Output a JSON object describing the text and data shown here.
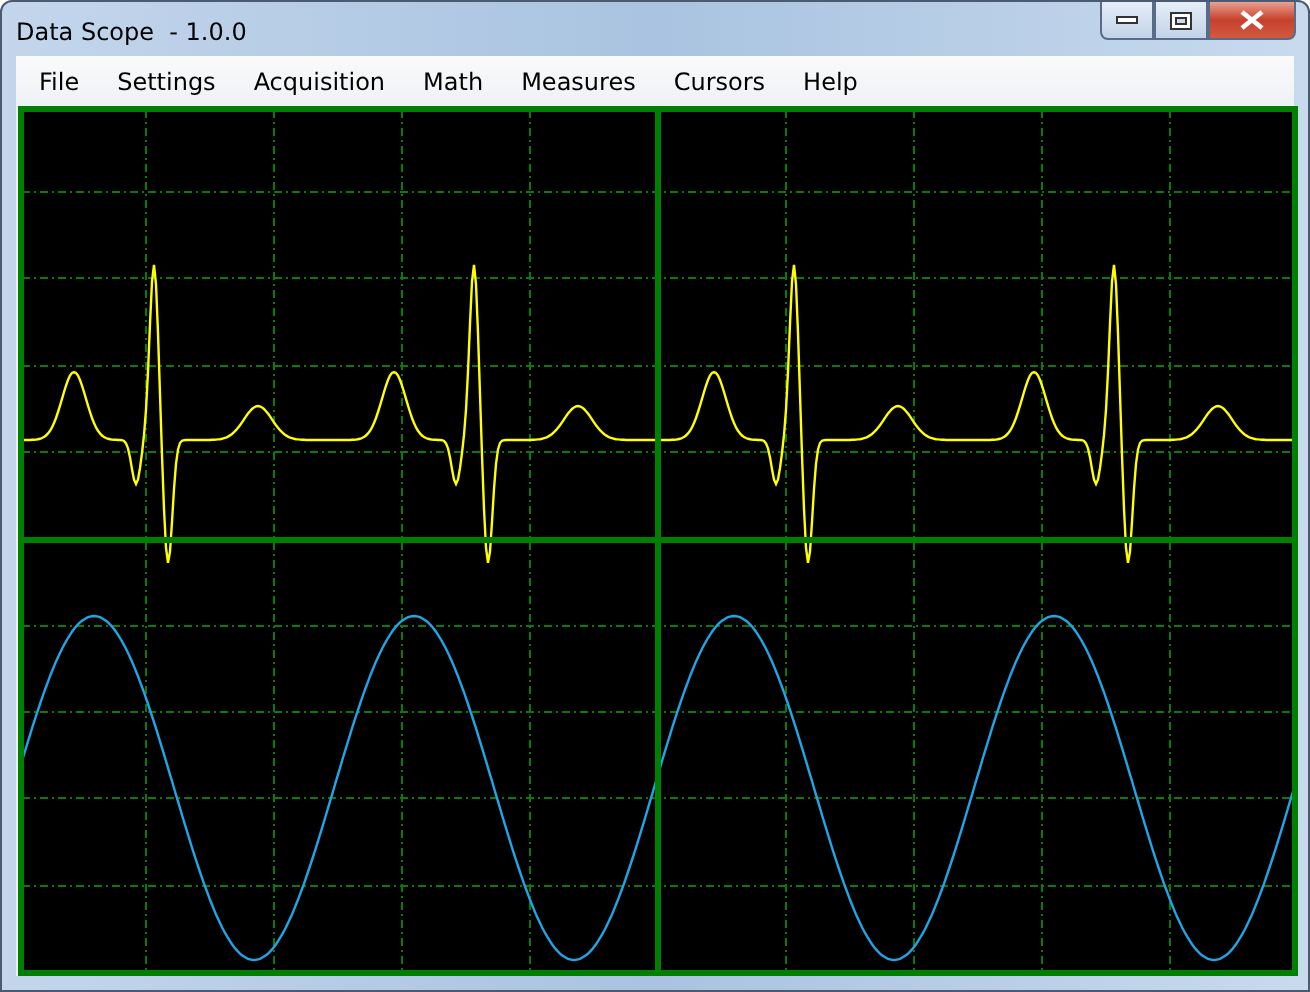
{
  "window": {
    "title": "Data Scope  - 1.0.0"
  },
  "menu": [
    {
      "label": "File"
    },
    {
      "label": "Settings"
    },
    {
      "label": "Acquisition"
    },
    {
      "label": "Math"
    },
    {
      "label": "Measures"
    },
    {
      "label": "Cursors"
    },
    {
      "label": "Help"
    }
  ]
}
